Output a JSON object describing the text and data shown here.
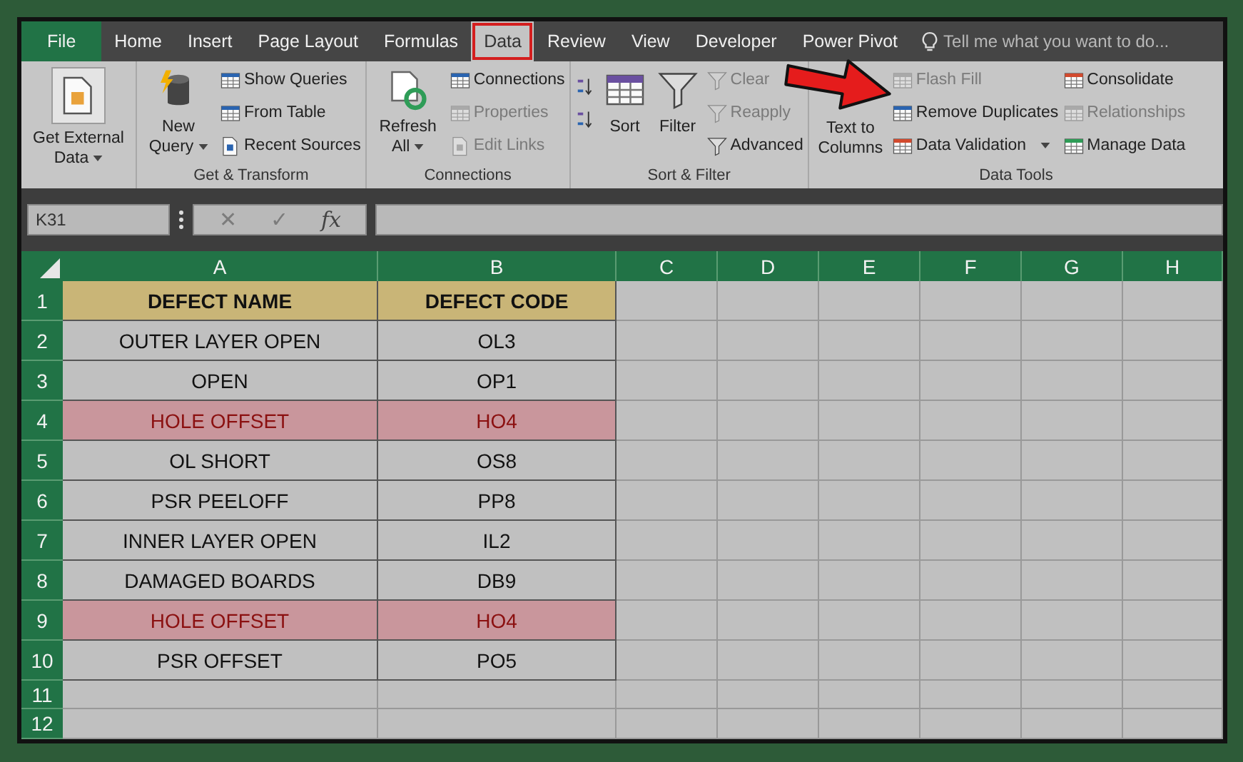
{
  "tabs": [
    {
      "label": "File",
      "kind": "file",
      "selected": false
    },
    {
      "label": "Home",
      "kind": "tab",
      "selected": false
    },
    {
      "label": "Insert",
      "kind": "tab",
      "selected": false
    },
    {
      "label": "Page Layout",
      "kind": "tab",
      "selected": false
    },
    {
      "label": "Formulas",
      "kind": "tab",
      "selected": false
    },
    {
      "label": "Data",
      "kind": "tab",
      "selected": true
    },
    {
      "label": "Review",
      "kind": "tab",
      "selected": false
    },
    {
      "label": "View",
      "kind": "tab",
      "selected": false
    },
    {
      "label": "Developer",
      "kind": "tab",
      "selected": false
    },
    {
      "label": "Power Pivot",
      "kind": "tab",
      "selected": false
    }
  ],
  "tell_me": {
    "placeholder": "Tell me what you want to do..."
  },
  "ribbon": {
    "groups": [
      {
        "commands": [
          {
            "label": "Get External Data",
            "kind": "large",
            "dropdown": true,
            "disabled": false
          }
        ]
      },
      {
        "label": "Get & Transform",
        "commands": [
          {
            "label": "New Query",
            "kind": "large",
            "dropdown": true,
            "disabled": false
          },
          {
            "label": "Show Queries",
            "kind": "small",
            "dropdown": false,
            "disabled": false
          },
          {
            "label": "From Table",
            "kind": "small",
            "dropdown": false,
            "disabled": false
          },
          {
            "label": "Recent Sources",
            "kind": "small",
            "dropdown": false,
            "disabled": false
          }
        ]
      },
      {
        "label": "Connections",
        "commands": [
          {
            "label": "Refresh All",
            "kind": "large",
            "dropdown": true,
            "disabled": false
          },
          {
            "label": "Connections",
            "kind": "small",
            "dropdown": false,
            "disabled": false
          },
          {
            "label": "Properties",
            "kind": "small",
            "dropdown": false,
            "disabled": true
          },
          {
            "label": "Edit Links",
            "kind": "small",
            "dropdown": false,
            "disabled": true
          }
        ]
      },
      {
        "label": "Sort & Filter",
        "commands": [
          {
            "kind": "icon",
            "disabled": false
          },
          {
            "kind": "icon",
            "disabled": false
          },
          {
            "label": "Sort",
            "kind": "large",
            "dropdown": false,
            "disabled": false
          },
          {
            "label": "Filter",
            "kind": "large",
            "dropdown": false,
            "disabled": false
          },
          {
            "label": "Clear",
            "kind": "small",
            "dropdown": false,
            "disabled": true
          },
          {
            "label": "Reapply",
            "kind": "small",
            "dropdown": false,
            "disabled": true
          },
          {
            "label": "Advanced",
            "kind": "small",
            "dropdown": false,
            "disabled": false
          }
        ]
      },
      {
        "label": "Data Tools",
        "commands": [
          {
            "label": "Text to Columns",
            "kind": "large",
            "dropdown": false,
            "disabled": false
          },
          {
            "label": "Flash Fill",
            "kind": "small",
            "dropdown": false,
            "disabled": true
          },
          {
            "label": "Remove Duplicates",
            "kind": "small",
            "dropdown": false,
            "disabled": false
          },
          {
            "label": "Data Validation",
            "kind": "small",
            "dropdown": true,
            "disabled": false
          },
          {
            "label": "Consolidate",
            "kind": "small",
            "dropdown": false,
            "disabled": false
          },
          {
            "label": "Relationships",
            "kind": "small",
            "dropdown": false,
            "disabled": true
          },
          {
            "label": "Manage Data",
            "kind": "small",
            "dropdown": false,
            "disabled": false
          }
        ]
      }
    ]
  },
  "formula_bar": {
    "name_box": "K31",
    "buttons": [
      {
        "label": "✕",
        "disabled": true
      },
      {
        "label": "✓",
        "disabled": true
      },
      {
        "label": "fx",
        "disabled": false
      }
    ]
  },
  "sheet": {
    "columns": [
      "A",
      "B",
      "C",
      "D",
      "E",
      "F",
      "G",
      "H"
    ],
    "rows": [
      {
        "number": "1",
        "kind": "header",
        "cells": [
          "DEFECT NAME",
          "DEFECT CODE"
        ]
      },
      {
        "number": "2",
        "kind": "normal",
        "cells": [
          "OUTER LAYER OPEN",
          "OL3"
        ]
      },
      {
        "number": "3",
        "kind": "normal",
        "cells": [
          "OPEN",
          "OP1"
        ]
      },
      {
        "number": "4",
        "kind": "duplicate",
        "cells": [
          "HOLE OFFSET",
          "HO4"
        ]
      },
      {
        "number": "5",
        "kind": "normal",
        "cells": [
          "OL SHORT",
          "OS8"
        ]
      },
      {
        "number": "6",
        "kind": "normal",
        "cells": [
          "PSR PEELOFF",
          "PP8"
        ]
      },
      {
        "number": "7",
        "kind": "normal",
        "cells": [
          "INNER LAYER OPEN",
          "IL2"
        ]
      },
      {
        "number": "8",
        "kind": "normal",
        "cells": [
          "DAMAGED BOARDS",
          "DB9"
        ]
      },
      {
        "number": "9",
        "kind": "duplicate",
        "cells": [
          "HOLE OFFSET",
          "HO4"
        ]
      },
      {
        "number": "10",
        "kind": "normal",
        "cells": [
          "PSR OFFSET",
          "PO5"
        ]
      },
      {
        "number": "11",
        "kind": "empty"
      },
      {
        "number": "12",
        "kind": "empty"
      }
    ]
  }
}
